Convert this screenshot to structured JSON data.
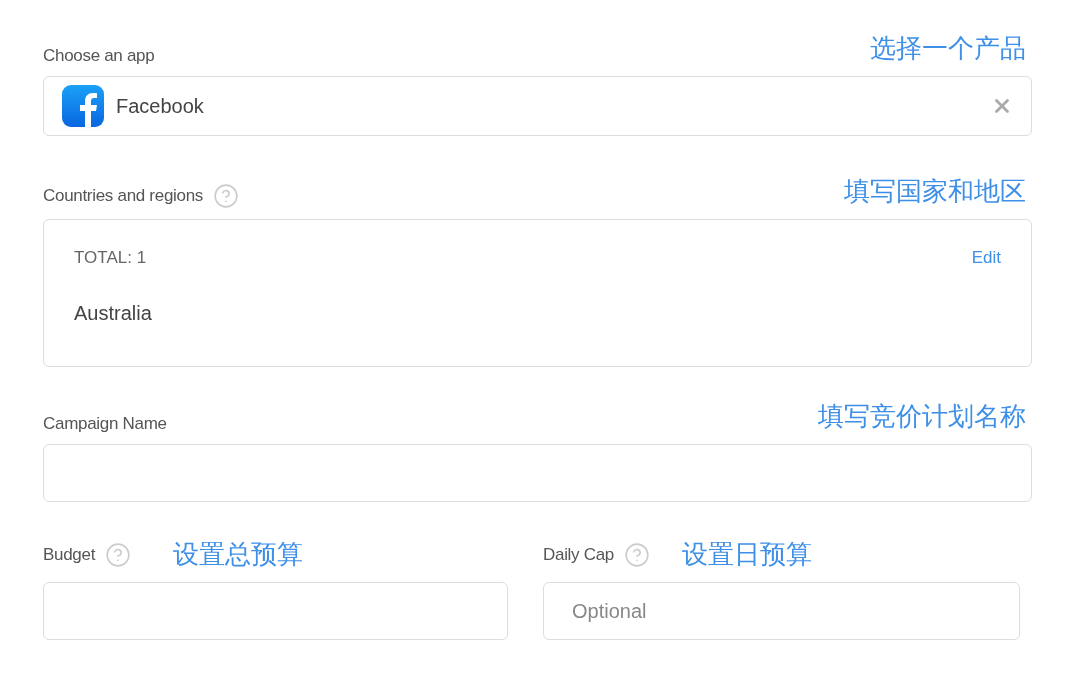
{
  "app_field": {
    "label": "Choose an app",
    "annotation": "选择一个产品",
    "value": "Facebook"
  },
  "countries": {
    "label": "Countries and regions",
    "annotation": "填写国家和地区",
    "total": "TOTAL: 1",
    "edit": "Edit",
    "items": [
      "Australia"
    ]
  },
  "campaign_name": {
    "label": "Campaign Name",
    "annotation": "填写竞价计划名称"
  },
  "budget": {
    "label": "Budget",
    "annotation": "设置总预算"
  },
  "daily_cap": {
    "label": "Daily Cap",
    "annotation": "设置日预算",
    "placeholder": "Optional"
  }
}
